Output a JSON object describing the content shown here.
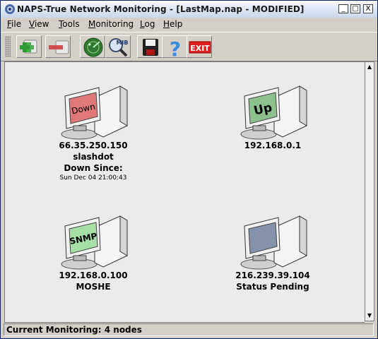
{
  "window": {
    "title": "NAPS-True Network Monitoring - [LastMap.nap - MODIFIED]",
    "buttons": {
      "minimize": "_",
      "maximize": "□",
      "close": "X"
    }
  },
  "menu": [
    "File",
    "View",
    "Tools",
    "Monitoring",
    "Log",
    "Help"
  ],
  "toolbar": {
    "buttons": [
      {
        "icon": "add-node-icon"
      },
      {
        "icon": "remove-node-icon"
      },
      {
        "icon": "radar-icon"
      },
      {
        "icon": "mib-browser-icon",
        "text": "MIB"
      },
      {
        "icon": "save-icon"
      },
      {
        "icon": "help-icon",
        "text": "?"
      },
      {
        "icon": "exit-icon",
        "text": "EXIT"
      }
    ]
  },
  "nodes": [
    {
      "screen_text": "Down",
      "screen_color": "#e07878",
      "ip": "66.35.250.150",
      "name": "slashdot",
      "extra": "Down Since:",
      "extra_small": "Sun Dec 04 21:00:43"
    },
    {
      "screen_text": "Up",
      "screen_color": "#8cc08c",
      "ip": "192.168.0.1"
    },
    {
      "screen_text": "SNMP",
      "screen_color": "#a6e0a6",
      "ip": "192.168.0.100",
      "name": "MOSHE"
    },
    {
      "screen_text": "",
      "screen_color": "#8592ab",
      "ip": "216.239.39.104",
      "name": "Status Pending"
    }
  ],
  "scrollbar": {
    "up": "▲",
    "down": "▼"
  },
  "status": "Current Monitoring: 4 nodes"
}
